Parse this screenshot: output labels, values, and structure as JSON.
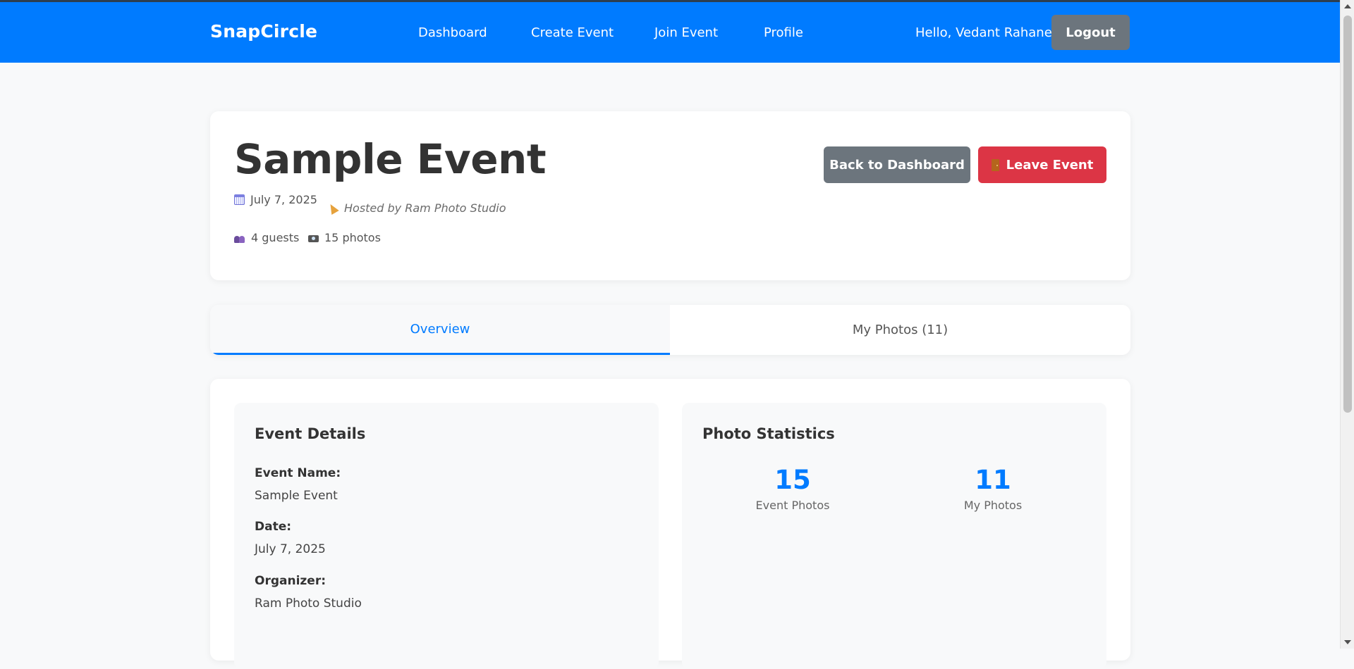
{
  "navbar": {
    "brand": "SnapCircle",
    "links": [
      "Dashboard",
      "Create Event",
      "Join Event",
      "Profile"
    ],
    "greeting": "Hello, Vedant Rahane",
    "logout_label": "Logout",
    "background_color": "#007bff"
  },
  "event": {
    "title": "Sample Event",
    "date": "July 7, 2025",
    "hosted_by": "Hosted by Ram Photo Studio",
    "guests": "4 guests",
    "photos": "15 photos",
    "icons": {
      "date": "calendar-icon",
      "host": "party-popper-icon",
      "guests": "people-icon",
      "photos": "camera-icon"
    }
  },
  "actions": {
    "back_label": "Back to Dashboard",
    "leave_label": "Leave Event",
    "leave_icon": "door-icon",
    "back_color": "#6c757d",
    "leave_color": "#dc3545"
  },
  "tabs": [
    {
      "label": "Overview",
      "active": true
    },
    {
      "label": "My Photos (11)",
      "active": false
    }
  ],
  "event_details": {
    "heading": "Event Details",
    "fields": [
      {
        "label": "Event Name:",
        "value": "Sample Event"
      },
      {
        "label": "Date:",
        "value": "July 7, 2025"
      },
      {
        "label": "Organizer:",
        "value": "Ram Photo Studio"
      }
    ]
  },
  "photo_statistics": {
    "heading": "Photo Statistics",
    "stats": [
      {
        "number": "15",
        "label": "Event Photos"
      },
      {
        "number": "11",
        "label": "My Photos"
      }
    ],
    "accent_color": "#007bff"
  }
}
